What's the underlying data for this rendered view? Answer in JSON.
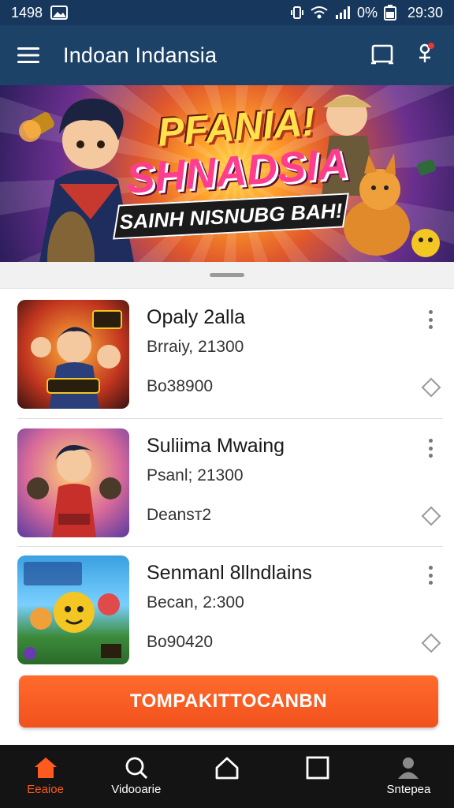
{
  "status_bar": {
    "left_text": "1498",
    "battery_text": "0%",
    "time": "29:30"
  },
  "app_bar": {
    "title": "Indoan Indansia"
  },
  "banner": {
    "title_line1": "PFANIA!",
    "title_line2": "SHNADSIA",
    "ribbon_text": "SAINH NISNUBG BAH!"
  },
  "list": {
    "items": [
      {
        "title": "Opaly 2alla",
        "subtitle": "Brraiy, 21300",
        "meta": "Bo38900"
      },
      {
        "title": "Suliima Mwaing",
        "subtitle": "Psanl; 21300",
        "meta": "Deansт2"
      },
      {
        "title": "Senmanl 8llndlains",
        "subtitle": "Becan, 2:300",
        "meta": "Bo90420"
      }
    ]
  },
  "cta": {
    "label": "TOMPAKITTOCANBN"
  },
  "bottom_nav": {
    "items": [
      {
        "label": "Eeaioe",
        "icon": "home-icon"
      },
      {
        "label": "Vidooarie",
        "icon": "search-icon"
      },
      {
        "label": "",
        "icon": "house-outline-icon"
      },
      {
        "label": "",
        "icon": "square-icon"
      },
      {
        "label": "Sntepea",
        "icon": "person-icon"
      }
    ],
    "active_color": "#ff5a1f"
  },
  "colors": {
    "status_bar": "#17385c",
    "app_bar": "#1d4268",
    "accent": "#f2521d"
  }
}
